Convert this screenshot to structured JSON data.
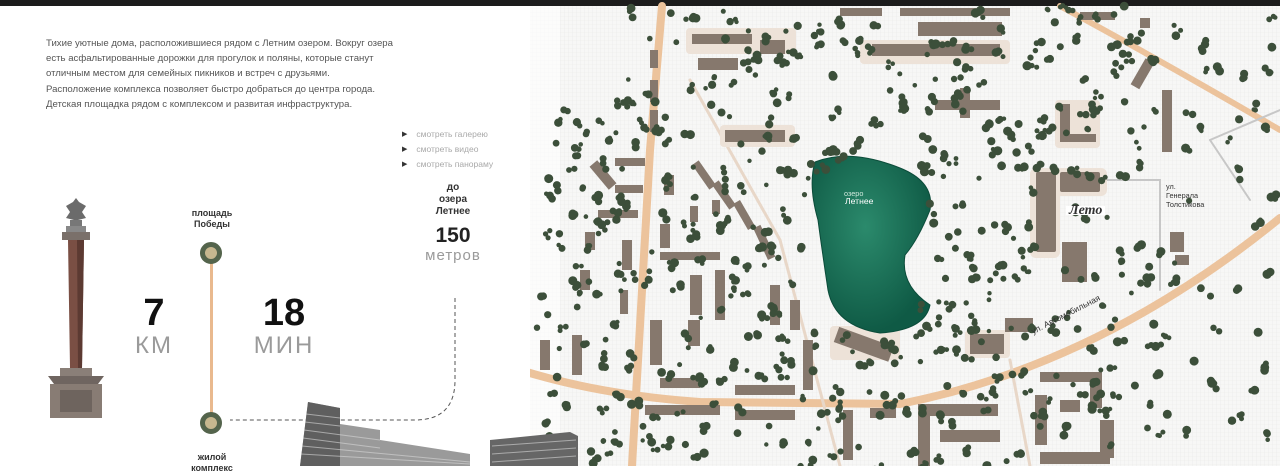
{
  "description": "Тихие уютные дома, расположившиеся рядом с Летним озером. Вокруг озера есть асфальтированные дорожки для прогулок и поляны, которые станут отличным местом для семейных пикников и встреч с друзьями. Расположение комплекса позволяет быстро добраться до центра города. Детская площадка рядом с комплексом и развитая инфраструктура.",
  "links": [
    {
      "label": "смотреть галерею",
      "icon": "play-icon"
    },
    {
      "label": "смотреть видео",
      "icon": "play-icon"
    },
    {
      "label": "смотреть панораму",
      "icon": "play-icon"
    }
  ],
  "lake_distance": {
    "label_line1": "до",
    "label_line2": "озера",
    "label_line3": "Летнее",
    "value": "150",
    "unit": "метров"
  },
  "route": {
    "start_line1": "площадь",
    "start_line2": "Победы",
    "end_line1": "жилой",
    "end_line2": "комплекс",
    "distance_value": "7",
    "distance_unit": "КМ",
    "time_value": "18",
    "time_unit": "МИН"
  },
  "map": {
    "lake_small": "озеро",
    "lake_name": "Летнее",
    "street_1": "ул. Автомобильная",
    "street_2_line1": "ул.",
    "street_2_line2": "Генерала",
    "street_2_line3": "Толстикова",
    "complex_logo": "Лето"
  },
  "colors": {
    "road": "#ecc39c",
    "building": "#86786d",
    "tree": "#3c4f3a",
    "lake": "#15664f",
    "route_line": "#e9b98e",
    "route_dot": "#54644c",
    "topbar": "#1c1c1c"
  }
}
